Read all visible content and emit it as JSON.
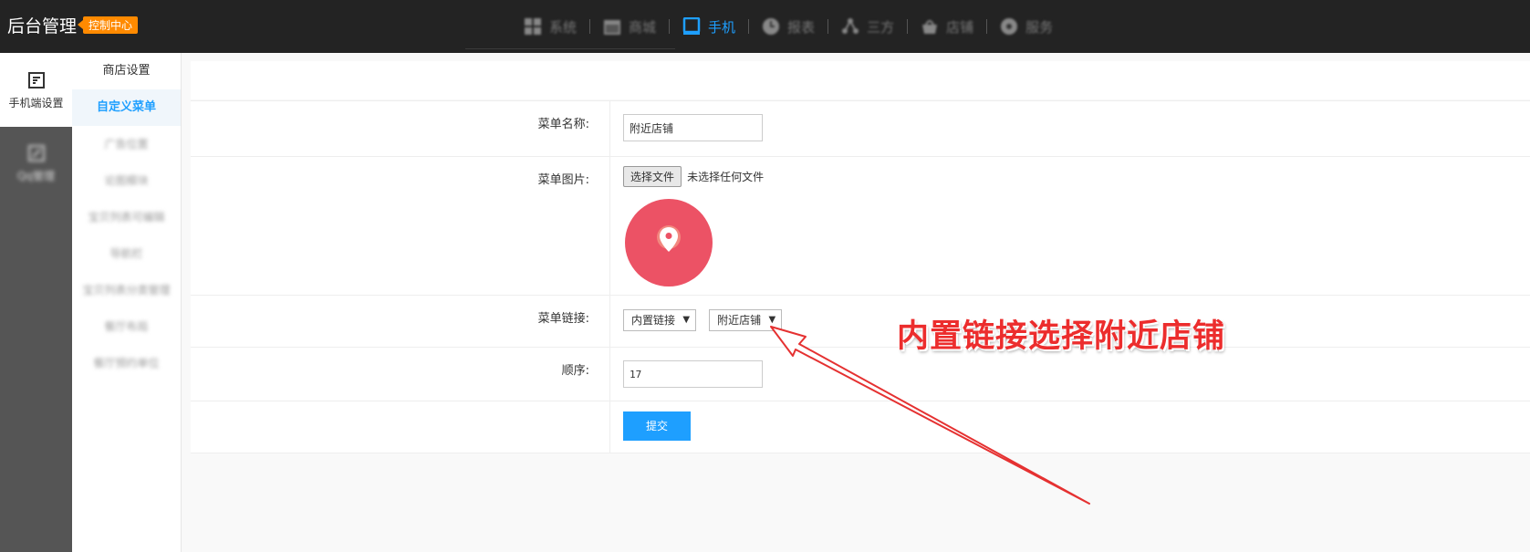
{
  "header": {
    "brand": "后台管理",
    "badge": "控制中心",
    "nav": [
      {
        "label": "系统",
        "icon": "grid-icon"
      },
      {
        "label": "商城",
        "icon": "calendar-icon"
      },
      {
        "label": "手机",
        "icon": "mobile-icon",
        "active": true
      },
      {
        "label": "报表",
        "icon": "clock-icon"
      },
      {
        "label": "三方",
        "icon": "network-icon"
      },
      {
        "label": "店铺",
        "icon": "shop-icon"
      },
      {
        "label": "服务",
        "icon": "service-icon"
      }
    ],
    "accent": "#1e9fff"
  },
  "left_nav": {
    "mobile_settings": "手机端设置",
    "other": "Qq管理"
  },
  "submenu": {
    "items": [
      "商店设置",
      "自定义菜单",
      "广告位置",
      "论图模块",
      "宝贝列表可编辑",
      "导航栏",
      "宝贝列表分类管理",
      "餐厅布局",
      "餐厅预约单位"
    ]
  },
  "form": {
    "menu_name": {
      "label": "菜单名称:",
      "value": "附近店铺"
    },
    "menu_image": {
      "label": "菜单图片:",
      "button": "选择文件",
      "status": "未选择任何文件",
      "preview_color": "#ec5265"
    },
    "menu_link": {
      "label": "菜单链接:",
      "type": "内置链接",
      "target": "附近店铺"
    },
    "order": {
      "label": "顺序:",
      "value": "17"
    },
    "submit": "提交"
  },
  "annotation": {
    "text": "内置链接选择附近店铺",
    "color": "#ec2d2d"
  }
}
